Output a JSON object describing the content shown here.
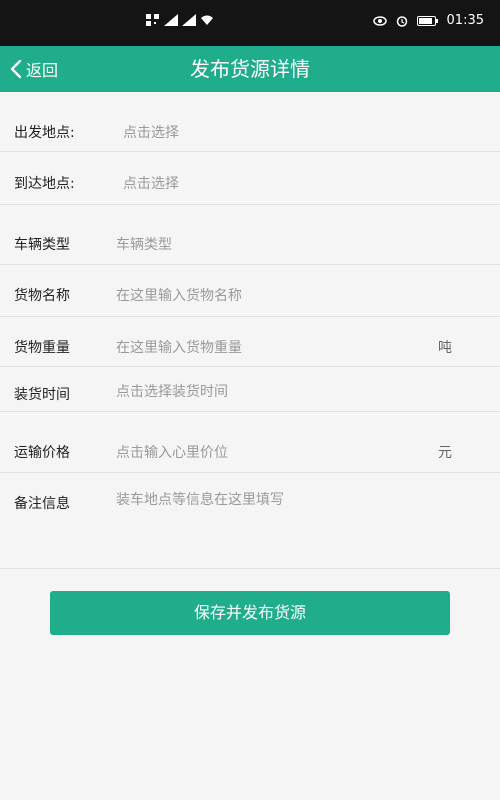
{
  "status_bar": {
    "time": "01:35",
    "icons": [
      "qr-icon",
      "signal-icon",
      "signal-icon",
      "wifi-icon",
      "eye-icon",
      "alarm-icon",
      "battery-icon"
    ]
  },
  "header": {
    "back_label": "返回",
    "title": "发布货源详情"
  },
  "form": {
    "departure": {
      "label": "出发地点:",
      "placeholder": "点击选择"
    },
    "arrival": {
      "label": "到达地点:",
      "placeholder": "点击选择"
    },
    "vehicle_type": {
      "label": "车辆类型",
      "placeholder": "车辆类型"
    },
    "cargo_name": {
      "label": "货物名称",
      "placeholder": "在这里输入货物名称"
    },
    "cargo_weight": {
      "label": "货物重量",
      "placeholder": "在这里输入货物重量",
      "unit": "吨"
    },
    "loading_time": {
      "label": "装货时间",
      "placeholder": "点击选择装货时间"
    },
    "freight_price": {
      "label": "运输价格",
      "placeholder": "点击输入心里价位",
      "unit": "元"
    },
    "remarks": {
      "label": "备注信息",
      "placeholder": "装车地点等信息在这里填写"
    }
  },
  "actions": {
    "save_label": "保存并发布货源"
  },
  "colors": {
    "accent": "#1fad8c",
    "status_bar": "#141414",
    "background": "#f5f5f5"
  }
}
